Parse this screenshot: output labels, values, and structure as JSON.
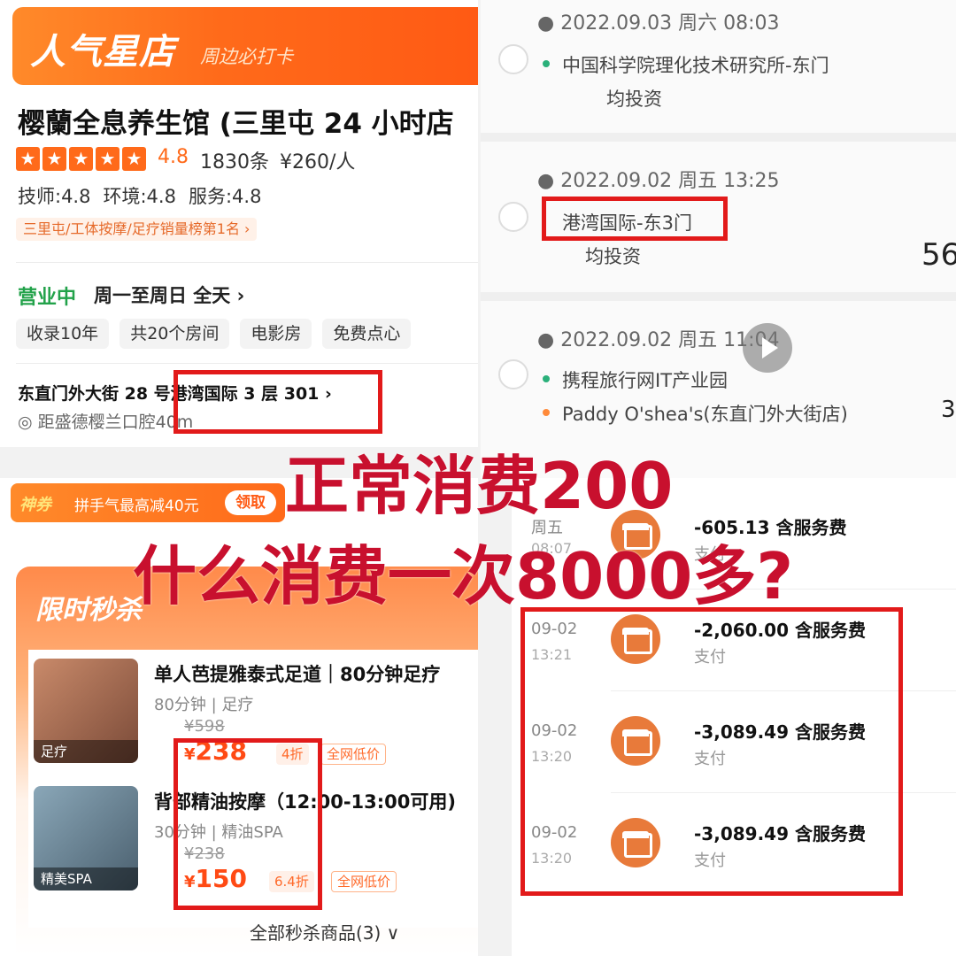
{
  "store": {
    "banner_title": "人气星店",
    "banner_subtitle": "周边必打卡",
    "name": "樱蘭全息养生馆 (三里屯 24 小时店",
    "rating": "4.8",
    "reviews": "1830条",
    "price_per_person": "¥260/人",
    "scores": [
      "技师:4.8",
      "环境:4.8",
      "服务:4.8"
    ],
    "rank_tag": "三里屯/工体按摩/足疗销量榜第1名 ›",
    "open_status": "营业中",
    "open_hours": "周一至周日 全天 ›",
    "chips": [
      "收录10年",
      "共20个房间",
      "电影房",
      "免费点心"
    ],
    "address": "东直门外大街 28 号港湾国际 3 层 301 ›",
    "distance": "距盛德樱兰口腔40m"
  },
  "trips": [
    {
      "time": "2022.09.03 周六 08:03",
      "from": "中国科学院理化技术研究所-东门",
      "to": "均投资",
      "amount": ""
    },
    {
      "time": "2022.09.02 周五 13:25",
      "from": "港湾国际-东3门",
      "to": "均投资",
      "amount": "56"
    },
    {
      "time": "2022.09.02 周五 11:04",
      "from": "携程旅行网IT产业园",
      "to": "Paddy O'shea's(东直门外大街店)",
      "amount": "3"
    }
  ],
  "coupon": {
    "tag": "神券",
    "text": "拼手气最高减40元",
    "button": "领取"
  },
  "flash_sale": {
    "title": "限时秒杀",
    "deals": [
      {
        "image_label": "足疗",
        "name": "单人芭提雅泰式足道｜80分钟足疗",
        "duration": "80分钟",
        "category": "足疗",
        "original_price": "¥598",
        "price": "238",
        "discount": "4折",
        "low_tag": "全网低价"
      },
      {
        "image_label": "精美SPA",
        "name": "背部精油按摩（12:00-13:00可用)",
        "duration": "30分钟",
        "category": "精油SPA",
        "original_price": "¥238",
        "price": "150",
        "discount": "6.4折",
        "low_tag": "全网低价"
      }
    ],
    "all_link": "全部秒杀商品(3) ∨"
  },
  "payments": [
    {
      "date": "周五",
      "time": "08:07",
      "amount": "-605.13 含服务费",
      "status": "支付"
    },
    {
      "date": "09-02",
      "time": "13:21",
      "amount": "-2,060.00 含服务费",
      "status": "支付"
    },
    {
      "date": "09-02",
      "time": "13:20",
      "amount": "-3,089.49 含服务费",
      "status": "支付"
    },
    {
      "date": "09-02",
      "time": "13:20",
      "amount": "-3,089.49 含服务费",
      "status": "支付"
    }
  ],
  "overlay": {
    "line1": "正常消费200",
    "line2": "什么消费一次8000多?"
  },
  "colors": {
    "accent_orange": "#ff6a1a",
    "highlight_red": "#e21a1a",
    "overlay_text": "#c8102e",
    "open_green": "#22a24a"
  }
}
